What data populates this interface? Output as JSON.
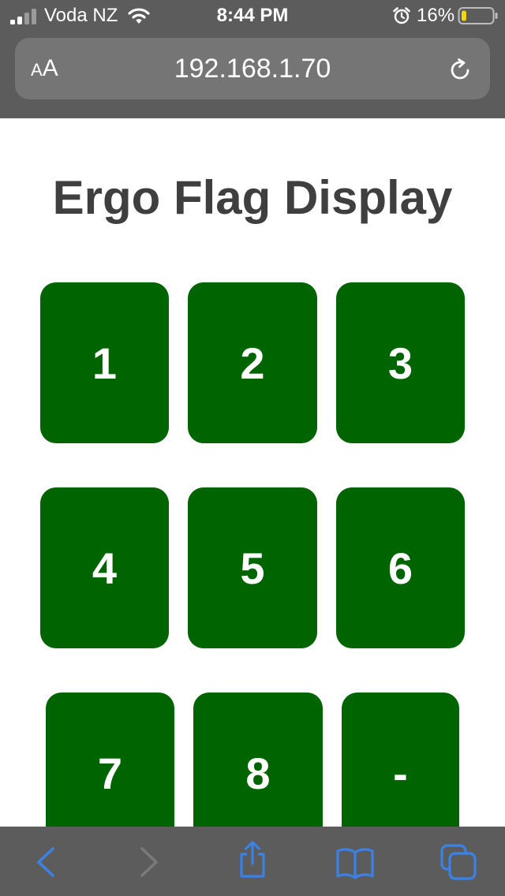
{
  "status_bar": {
    "carrier": "Voda NZ",
    "time": "8:44 PM",
    "battery_percent": "16%",
    "battery_level": 0.16,
    "signal_bars_active": 2,
    "signal_bars_total": 4
  },
  "browser": {
    "text_size_label_small": "A",
    "text_size_label_big": "A",
    "url": "192.168.1.70"
  },
  "page": {
    "title": "Ergo Flag Display",
    "buttons": [
      "1",
      "2",
      "3",
      "4",
      "5",
      "6",
      "7",
      "8",
      "-"
    ]
  },
  "colors": {
    "button_green": "#006400",
    "chrome_gray": "#5c5c5c",
    "address_bar_gray": "#757575",
    "title_text": "#3f3f3f",
    "toolbar_icon_blue": "#3b82e6",
    "toolbar_icon_disabled": "#7a7a7a",
    "battery_yellow": "#f5d90a"
  },
  "toolbar": {
    "icons": [
      "back-icon",
      "forward-icon",
      "share-icon",
      "bookmarks-icon",
      "tabs-icon"
    ]
  }
}
